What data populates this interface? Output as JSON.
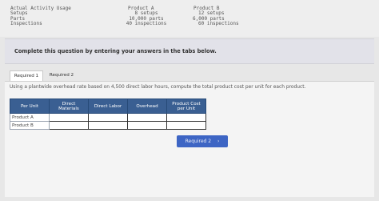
{
  "activity": {
    "labels": [
      "Actual Activity Usage",
      "Setups",
      "Parts",
      "Inspections"
    ],
    "product_a": {
      "name": "Product A",
      "setups": "8 setups",
      "parts": "10,000 parts",
      "inspections": "40 inspections"
    },
    "product_b": {
      "name": "Product B",
      "setups": "12 setups",
      "parts": "6,000 parts",
      "inspections": "60 inspections"
    }
  },
  "banner": "Complete this question by entering your answers in the tabs below.",
  "tabs": [
    {
      "label": "Required 1",
      "active": true
    },
    {
      "label": "Required 2",
      "active": false
    }
  ],
  "question": "Using a plantwide overhead rate based on 4,500 direct labor hours, compute the total product cost per unit for each product.",
  "table": {
    "headers": [
      "Per Unit",
      "Direct Materials",
      "Direct Labor",
      "Overhead",
      "Product Cost per Unit"
    ],
    "header_lines": {
      "direct_materials": [
        "Direct",
        "Materials"
      ],
      "product_cost": [
        "Product Cost",
        "per Unit"
      ]
    },
    "rows": [
      {
        "label": "Product A",
        "values": [
          "",
          "",
          "",
          ""
        ]
      },
      {
        "label": "Product B",
        "values": [
          "",
          "",
          "",
          ""
        ]
      }
    ]
  },
  "next_button": {
    "label": "Required 2",
    "chevron": "›"
  }
}
